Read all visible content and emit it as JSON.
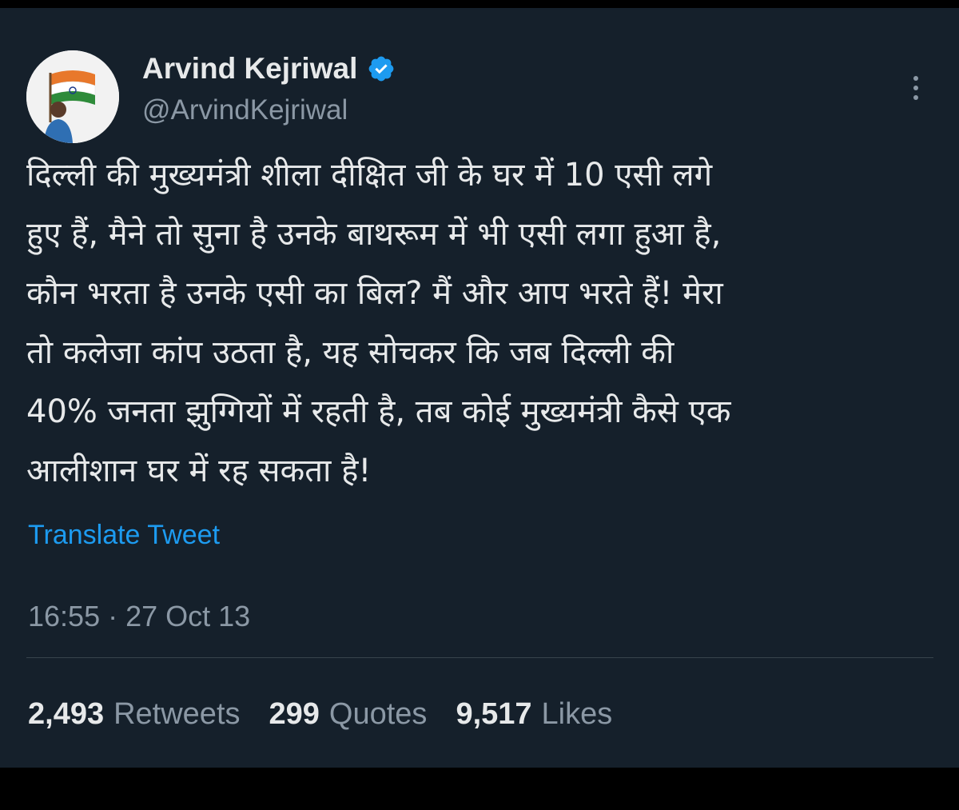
{
  "author": {
    "display_name": "Arvind Kejriwal",
    "handle": "@ArvindKejriwal",
    "verified": true,
    "avatar_icon": "profile-photo-with-flag"
  },
  "tweet": {
    "lines": [
      "दिल्ली की मुख्यमंत्री शीला दीक्षित जी के घर में 10 एसी लगे",
      "हुए हैं, मैने तो सुना है उनके बाथरूम में भी एसी लगा हुआ है,",
      "कौन भरता है उनके एसी का बिल? मैं और आप भरते हैं! मेरा",
      "तो कलेजा कांप उठता है, यह सोचकर कि जब दिल्ली की",
      "40% जनता झुग्गियों में रहती है, तब कोई मुख्यमंत्री कैसे एक",
      "आलीशान घर में रह सकता है!"
    ],
    "translate_label": "Translate Tweet",
    "timestamp": "16:55 · 27 Oct 13"
  },
  "stats": {
    "retweets_count": "2,493",
    "retweets_label": "Retweets",
    "quotes_count": "299",
    "quotes_label": "Quotes",
    "likes_count": "9,517",
    "likes_label": "Likes"
  },
  "colors": {
    "background": "#15202b",
    "text": "#e7e9ea",
    "secondary": "#8b98a5",
    "link": "#1d9bf0",
    "verified": "#1d9bf0",
    "divider": "#38444d"
  },
  "icons": {
    "verified": "verified-badge-icon",
    "more": "more-options-icon"
  }
}
